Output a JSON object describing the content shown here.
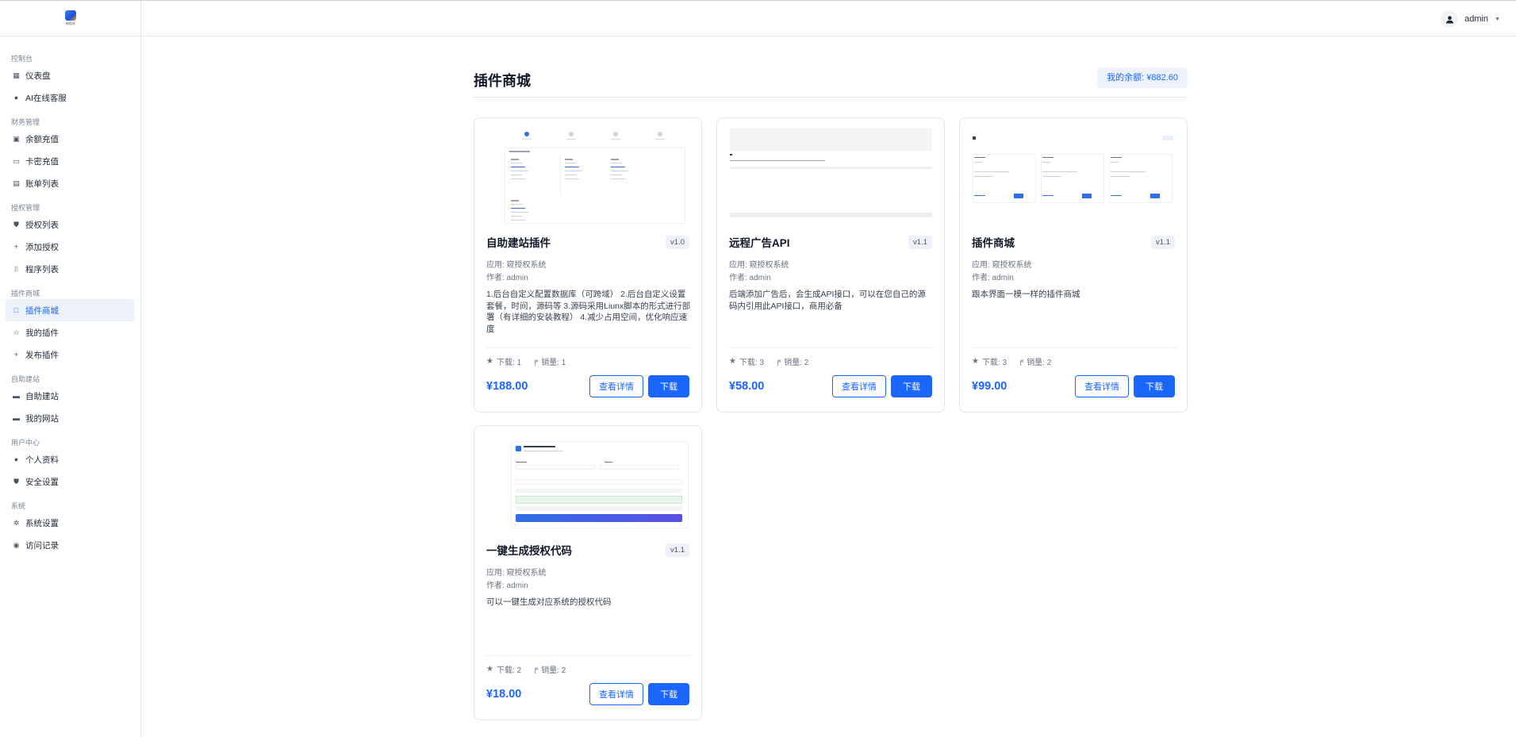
{
  "sidebar": {
    "logo_text": "授权网",
    "groups": [
      {
        "label": "控制台",
        "items": [
          {
            "label": "仪表盘",
            "icon": "dashboard-icon"
          },
          {
            "label": "AI在线客服",
            "icon": "robot-icon"
          }
        ]
      },
      {
        "label": "财务管理",
        "items": [
          {
            "label": "余额充值",
            "icon": "wallet-icon"
          },
          {
            "label": "卡密充值",
            "icon": "card-icon"
          },
          {
            "label": "账单列表",
            "icon": "bill-icon"
          }
        ]
      },
      {
        "label": "授权管理",
        "items": [
          {
            "label": "授权列表",
            "icon": "shield-icon"
          },
          {
            "label": "添加授权",
            "icon": "plus-icon"
          },
          {
            "label": "程序列表",
            "icon": "grid-icon"
          }
        ]
      },
      {
        "label": "插件商城",
        "items": [
          {
            "label": "插件商城",
            "icon": "bag-icon",
            "active": true
          },
          {
            "label": "我的插件",
            "icon": "star-icon"
          },
          {
            "label": "发布插件",
            "icon": "plus-icon"
          }
        ]
      },
      {
        "label": "自助建站",
        "items": [
          {
            "label": "自助建站",
            "icon": "site-icon"
          },
          {
            "label": "我的网站",
            "icon": "folder-icon"
          }
        ]
      },
      {
        "label": "用户中心",
        "items": [
          {
            "label": "个人资料",
            "icon": "user-icon"
          },
          {
            "label": "安全设置",
            "icon": "shield-icon"
          }
        ]
      },
      {
        "label": "系统",
        "items": [
          {
            "label": "系统设置",
            "icon": "gear-icon"
          },
          {
            "label": "访问记录",
            "icon": "eye-icon"
          }
        ]
      }
    ]
  },
  "header": {
    "username": "admin"
  },
  "page": {
    "title": "插件商城",
    "balance": "我的余额: ¥882.60"
  },
  "labels": {
    "detail": "查看详情",
    "download": "下载"
  },
  "plugins": [
    {
      "name": "自助建站插件",
      "version": "v1.0",
      "app": "应用: 窥授权系统",
      "author": "作者: admin",
      "description": "1.后台自定义配置数据库（可跨域） 2.后台自定义设置套餐，时间，源码等 3.源码采用Liunx脚本的形式进行部署（有详细的安装教程） 4.减少占用空间，优化响应速度",
      "downloads": "下载: 1",
      "sales": "销量: 1",
      "price": "¥188.00"
    },
    {
      "name": "远程广告API",
      "version": "v1.1",
      "app": "应用: 窥授权系统",
      "author": "作者: admin",
      "description": "后端添加广告后，会生成API接口，可以在您自己的源码内引用此API接口，商用必备",
      "downloads": "下载: 3",
      "sales": "销量: 2",
      "price": "¥58.00"
    },
    {
      "name": "插件商城",
      "version": "v1.1",
      "app": "应用: 窥授权系统",
      "author": "作者: admin",
      "description": "跟本界面一模一样的插件商城",
      "downloads": "下载: 3",
      "sales": "销量: 2",
      "price": "¥99.00"
    },
    {
      "name": "一键生成授权代码",
      "version": "v1.1",
      "app": "应用: 窥授权系统",
      "author": "作者: admin",
      "description": "可以一键生成对应系统的授权代码",
      "downloads": "下载: 2",
      "sales": "销量: 2",
      "price": "¥18.00"
    }
  ]
}
